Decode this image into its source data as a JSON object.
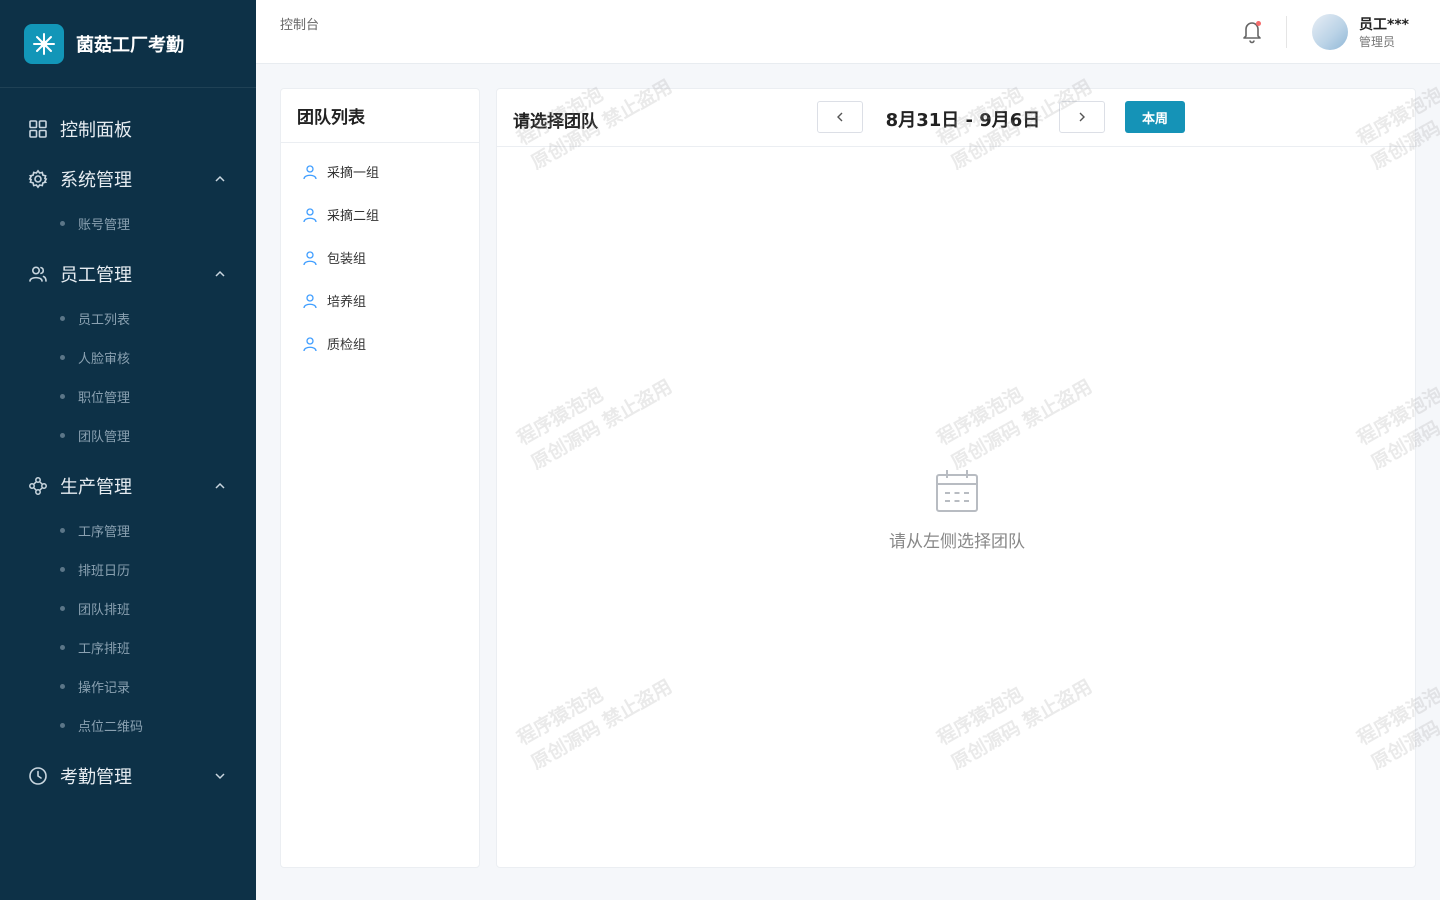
{
  "brand": {
    "name": "菌菇工厂考勤"
  },
  "sidebar": {
    "menu": [
      {
        "label": "控制面板",
        "icon": "dashboard-icon",
        "expanded": false,
        "children": []
      },
      {
        "label": "系统管理",
        "icon": "gear-icon",
        "expanded": true,
        "children": [
          "账号管理"
        ]
      },
      {
        "label": "员工管理",
        "icon": "users-icon",
        "expanded": true,
        "children": [
          "员工列表",
          "人脸审核",
          "职位管理",
          "团队管理"
        ]
      },
      {
        "label": "生产管理",
        "icon": "production-icon",
        "expanded": true,
        "children": [
          "工序管理",
          "排班日历",
          "团队排班",
          "工序排班",
          "操作记录",
          "点位二维码"
        ]
      },
      {
        "label": "考勤管理",
        "icon": "clock-icon",
        "expanded": false,
        "children": []
      }
    ]
  },
  "header": {
    "breadcrumb": "控制台",
    "user": {
      "name": "员工***",
      "role": "管理员"
    }
  },
  "team_panel": {
    "title": "团队列表",
    "teams": [
      "采摘一组",
      "采摘二组",
      "包装组",
      "培养组",
      "质检组"
    ]
  },
  "main": {
    "title": "请选择团队",
    "date_range": "8月31日 - 9月6日",
    "week_button": "本周",
    "empty_text": "请从左侧选择团队"
  },
  "watermark": {
    "line1": "程序猿泡泡",
    "line2": "原创源码 禁止盗用"
  },
  "colors": {
    "sidebar_bg": "#0d3147",
    "accent": "#1593b7",
    "logo_bg": "#1296b8",
    "notify_dot": "#f56c6c"
  }
}
